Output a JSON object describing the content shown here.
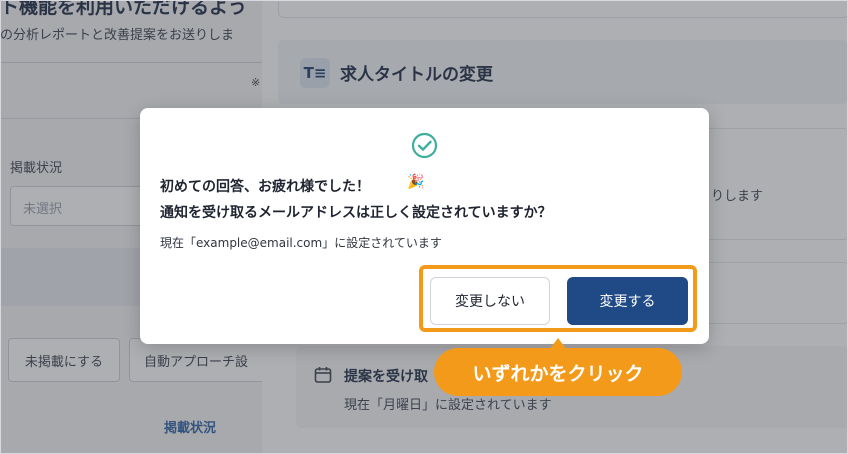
{
  "background_left": {
    "heading": "ト機能を利用いただけるよう",
    "subtext": "の分析レポートと改善提案をお送りしま",
    "note_mark": "※",
    "status_label": "掲載状況",
    "status_select_placeholder": "未選択",
    "unpublish_button": "未掲載にする",
    "auto_approach_button": "自動アプローチ設",
    "status_link": "掲載状況"
  },
  "background_right": {
    "title_icon": "T≡",
    "section_title": "求人タイトルの変更",
    "card2_text": "りします",
    "card4_title": "提案を受け取",
    "card4_sub": "現在「月曜日」に設定されています"
  },
  "dialog": {
    "line1": "初めての回答、お疲れ様でした！",
    "party_emoji": "🎉",
    "line2": "通知を受け取るメールアドレスは正しく設定されていますか？",
    "line3": "現在「example@email.com」に設定されています",
    "secondary_button": "変更しない",
    "primary_button": "変更する"
  },
  "annotation": {
    "callout_text": "いずれかをクリック"
  },
  "colors": {
    "accent_orange": "#f39a1a",
    "primary_blue": "#1f4a86",
    "check_teal": "#3fae9c"
  }
}
